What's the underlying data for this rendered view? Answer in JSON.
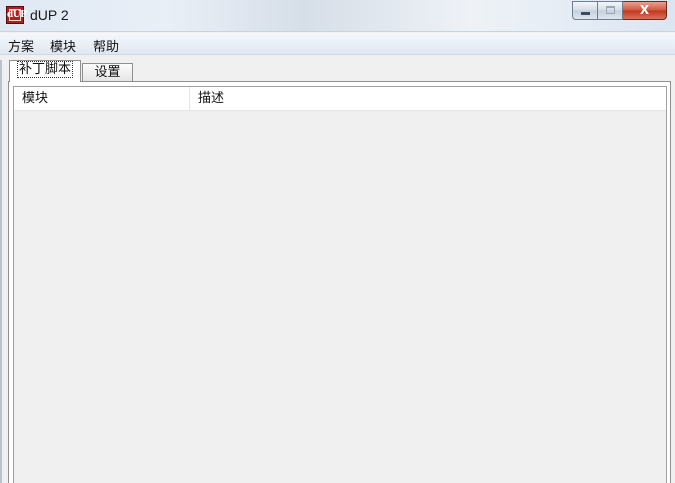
{
  "window": {
    "title": "dUP 2",
    "icon": "dup-app-icon",
    "icon_text": "dUP",
    "controls": {
      "minimize": "minimize-icon",
      "maximize": "maximize-icon",
      "close": "close-icon",
      "close_glyph": "X"
    }
  },
  "menubar": {
    "items": [
      {
        "label": "方案"
      },
      {
        "label": "模块"
      },
      {
        "label": "帮助"
      }
    ]
  },
  "tabs": [
    {
      "label": "补丁脚本",
      "selected": true
    },
    {
      "label": "设置",
      "selected": false
    }
  ],
  "list": {
    "columns": [
      "模块",
      "描述"
    ],
    "rows": []
  },
  "colors": {
    "close_button": "#c0351c",
    "app_icon": "#b41e1e",
    "background": "#f0f0f0"
  }
}
